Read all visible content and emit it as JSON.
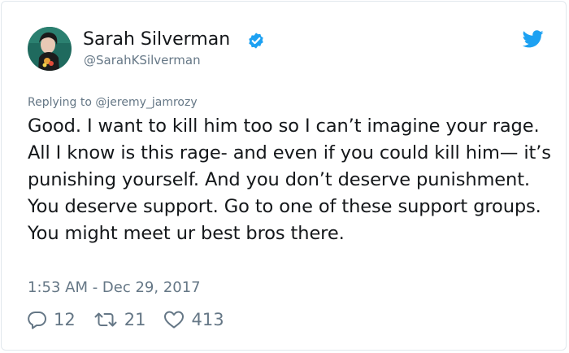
{
  "tweet": {
    "author": {
      "display_name": "Sarah Silverman",
      "handle": "@SarahKSilverman",
      "verified": true
    },
    "reply_to": "Replying to @jeremy_jamrozy",
    "text": "Good. I want to kill him too so I can’t imagine your rage. All I know is this rage- and even if you could kill him— it’s punishing yourself. And you don’t deserve punishment. You deserve support. Go to one of these support groups. You might meet ur best bros there.",
    "timestamp": "1:53 AM - Dec 29, 2017",
    "stats": {
      "replies": "12",
      "retweets": "21",
      "likes": "413"
    }
  },
  "colors": {
    "text_primary": "#14171a",
    "text_secondary": "#657786",
    "twitter_blue": "#1da1f2",
    "border": "#e1e8ed"
  },
  "icons": {
    "verified": "verified-badge-icon",
    "brand": "twitter-bird-icon",
    "reply": "reply-icon",
    "retweet": "retweet-icon",
    "like": "heart-icon"
  }
}
